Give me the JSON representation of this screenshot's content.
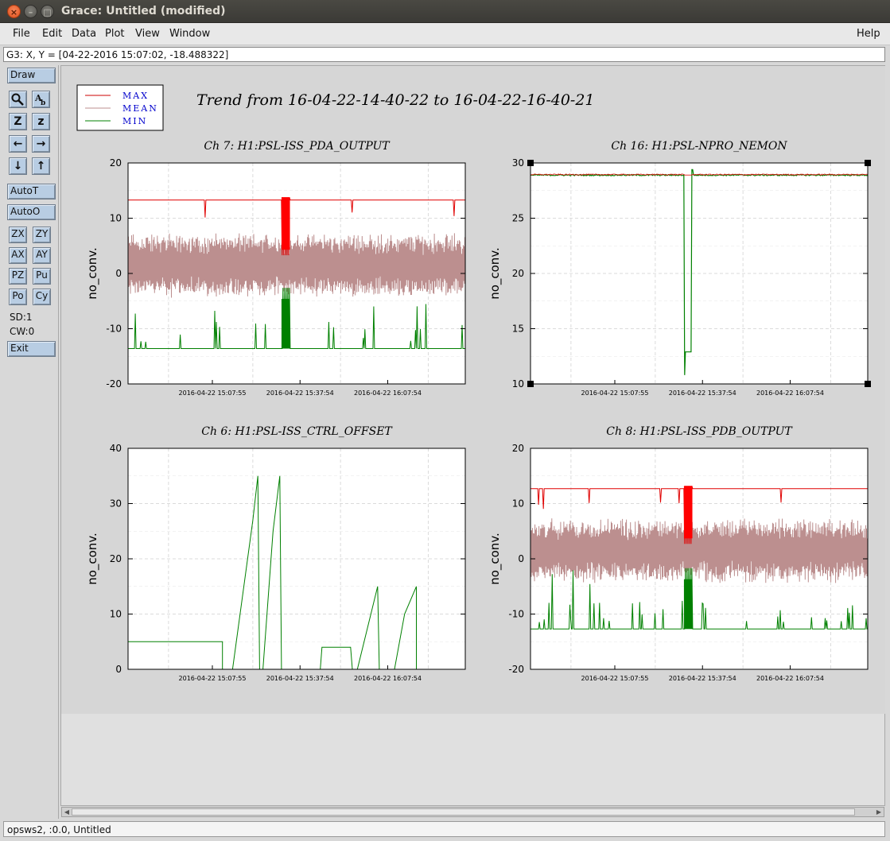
{
  "window": {
    "title": "Grace: Untitled (modified)",
    "close_glyph": "×",
    "min_glyph": "–",
    "max_glyph": "□"
  },
  "menubar": {
    "items": [
      {
        "label": "File"
      },
      {
        "label": "Edit"
      },
      {
        "label": "Data"
      },
      {
        "label": "Plot"
      },
      {
        "label": "View"
      },
      {
        "label": "Window"
      }
    ],
    "help": "Help"
  },
  "locator": "G3: X, Y = [04-22-2016 15:07:02, -18.488322]",
  "toolbar": {
    "draw": "Draw",
    "autot": "AutoT",
    "autoo": "AutoO",
    "zx": "ZX",
    "zy": "ZY",
    "ax": "AX",
    "ay": "AY",
    "pz": "PZ",
    "pu": "Pu",
    "po": "Po",
    "cy": "Cy",
    "sd": "SD:1",
    "cw": "CW:0",
    "exit": "Exit",
    "icons": {
      "zoom": "zoom-icon",
      "text": "text-icon",
      "zoom_in": "Z",
      "zoom_out": "z",
      "left": "←",
      "right": "→",
      "down": "↓",
      "up": "↑"
    }
  },
  "figure": {
    "main_title": "Trend from 16-04-22-14-40-22 to 16-04-22-16-40-21",
    "legend": [
      {
        "label": "MAX",
        "color": "#cc0000"
      },
      {
        "label": "MEAN",
        "color": "#bc8f8f"
      },
      {
        "label": "MIN",
        "color": "#008000"
      }
    ],
    "legend_text_color": "#0000cc"
  },
  "chart_data": [
    {
      "type": "line",
      "title": "Ch 7: H1:PSL-ISS_PDA_OUTPUT",
      "ylabel": "no_conv.",
      "ylim": [
        -20,
        20
      ],
      "yticks": [
        "20",
        "10",
        "0",
        "-10",
        "-20"
      ],
      "xticks": [
        "2016-04-22 15:07:55",
        "2016-04-22 15:37:54",
        "2016-04-22 16:07:54"
      ],
      "series": [
        {
          "name": "MAX",
          "values_level": 13.3
        },
        {
          "name": "MEAN",
          "values_level": 1.5
        },
        {
          "name": "MIN",
          "values_level": -13.6
        }
      ]
    },
    {
      "type": "line",
      "title": "Ch 16: H1:PSL-NPRO_NEMON",
      "ylabel": "no_conv.",
      "ylim": [
        10,
        30
      ],
      "yticks": [
        "30",
        "25",
        "20",
        "15",
        "10"
      ],
      "xticks": [
        "2016-04-22 15:07:55",
        "2016-04-22 15:37:54",
        "2016-04-22 16:07:54"
      ],
      "series": [
        {
          "name": "MAX",
          "values_level": 29.0
        },
        {
          "name": "MEAN",
          "values_level": 28.9
        },
        {
          "name": "MIN",
          "values_level": 28.8
        }
      ]
    },
    {
      "type": "line",
      "title": "Ch 6: H1:PSL-ISS_CTRL_OFFSET",
      "ylabel": "no_conv.",
      "ylim": [
        0,
        40
      ],
      "yticks": [
        "40",
        "30",
        "20",
        "10",
        "0"
      ],
      "xticks": [
        "2016-04-22 15:07:55",
        "2016-04-22 15:37:54",
        "2016-04-22 16:07:54"
      ],
      "series": [
        {
          "name": "MIN",
          "values_level": 5
        }
      ]
    },
    {
      "type": "line",
      "title": "Ch 8: H1:PSL-ISS_PDB_OUTPUT",
      "ylabel": "no_conv.",
      "ylim": [
        -20,
        20
      ],
      "yticks": [
        "20",
        "10",
        "0",
        "-10",
        "-20"
      ],
      "xticks": [
        "2016-04-22 15:07:55",
        "2016-04-22 15:37:54",
        "2016-04-22 16:07:54"
      ],
      "series": [
        {
          "name": "MAX",
          "values_level": 12.7
        },
        {
          "name": "MEAN",
          "values_level": 1.5
        },
        {
          "name": "MIN",
          "values_level": -12.7
        }
      ]
    }
  ],
  "statusbar": "opsws2, :0.0, Untitled"
}
